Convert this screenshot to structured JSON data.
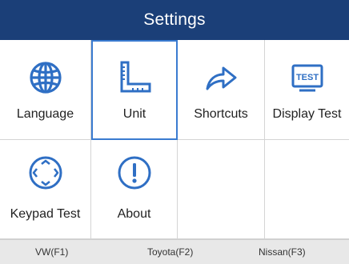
{
  "window": {
    "title": "Settings"
  },
  "colors": {
    "header": "#1b3f78",
    "icon": "#2f6fc4",
    "selection_border": "#3a7bd0"
  },
  "tiles": [
    {
      "label": "Language",
      "icon": "globe-icon"
    },
    {
      "label": "Unit",
      "icon": "ruler-icon"
    },
    {
      "label": "Shortcuts",
      "icon": "arrow-right-icon"
    },
    {
      "label": "Display Test",
      "icon": "test-display-icon"
    },
    {
      "label": "Keypad Test",
      "icon": "keypad-icon"
    },
    {
      "label": "About",
      "icon": "info-icon"
    }
  ],
  "selected_tile": "Unit",
  "footer": {
    "keys": [
      {
        "label": "VW(F1)"
      },
      {
        "label": "Toyota(F2)"
      },
      {
        "label": "Nissan(F3)"
      }
    ]
  }
}
